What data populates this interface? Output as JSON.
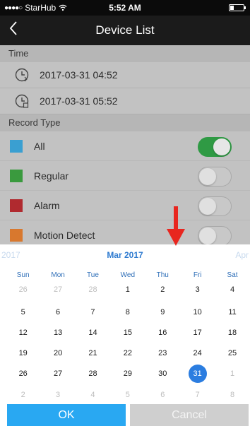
{
  "status_bar": {
    "carrier": "StarHub",
    "time": "5:52 AM",
    "battery_level": 0.3
  },
  "nav": {
    "back_icon": "chevron-left-icon",
    "title": "Device List"
  },
  "time_section": {
    "header": "Time",
    "start_time": "2017-03-31 04:52",
    "end_time": "2017-03-31 05:52"
  },
  "record_type": {
    "header": "Record Type",
    "items": [
      {
        "label": "All",
        "color": "#3a9fd1",
        "enabled": true
      },
      {
        "label": "Regular",
        "color": "#3a9a3e",
        "enabled": false
      },
      {
        "label": "Alarm",
        "color": "#b02a2f",
        "enabled": false
      },
      {
        "label": "Motion Detect",
        "color": "#d8782e",
        "enabled": false
      }
    ]
  },
  "annotation": {
    "arrow_color": "#e8261f"
  },
  "calendar": {
    "prev_month": "2017",
    "current_month": "Mar 2017",
    "next_month": "Apr",
    "weekdays": [
      "Sun",
      "Mon",
      "Tue",
      "Wed",
      "Thu",
      "Fri",
      "Sat"
    ],
    "weeks": [
      [
        "26",
        "27",
        "28",
        "1",
        "2",
        "3",
        "4"
      ],
      [
        "5",
        "6",
        "7",
        "8",
        "9",
        "10",
        "11"
      ],
      [
        "12",
        "13",
        "14",
        "15",
        "16",
        "17",
        "18"
      ],
      [
        "19",
        "20",
        "21",
        "22",
        "23",
        "24",
        "25"
      ],
      [
        "26",
        "27",
        "28",
        "29",
        "30",
        "31",
        "1"
      ],
      [
        "2",
        "3",
        "4",
        "5",
        "6",
        "7",
        "8"
      ]
    ],
    "selected_day": "31",
    "accent_color": "#2b7de0"
  },
  "buttons": {
    "ok": "OK",
    "cancel": "Cancel"
  }
}
